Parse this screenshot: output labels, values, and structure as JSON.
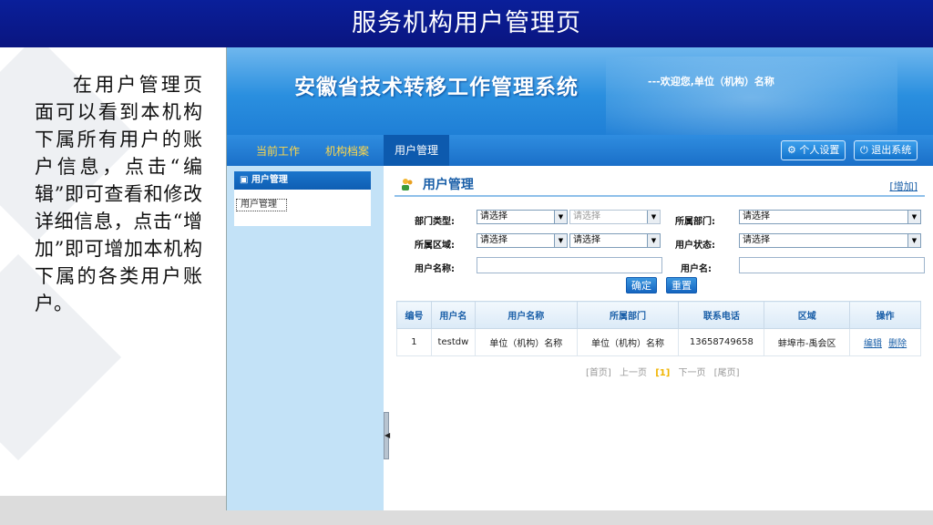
{
  "slide": {
    "title": "服务机构用户管理页",
    "description": "在用户管理页面可以看到本机构下属所有用户的账户信息，点击“编辑”即可查看和修改详细信息，点击“增加”即可增加本机构下属的各类用户账户。"
  },
  "system": {
    "title": "安徽省技术转移工作管理系统",
    "welcome": "---欢迎您,单位（机构）名称"
  },
  "nav": {
    "items": [
      "当前工作",
      "机构档案",
      "用户管理"
    ],
    "active": "用户管理",
    "settings_label": "个人设置",
    "logout_label": "退出系统",
    "settings_icon": "gear-icon",
    "logout_icon": "power-icon"
  },
  "sidebar": {
    "header": "用户管理",
    "items": [
      "用户管理"
    ]
  },
  "panel": {
    "title": "用户管理",
    "add_label": "[增加]"
  },
  "filters": {
    "dept_type_label": "部门类型:",
    "dept_type_value": "请选择",
    "dept_type_sub_value": "请选择",
    "dept_label": "所属部门:",
    "dept_value": "请选择",
    "region_label": "所属区域:",
    "region_value": "请选择",
    "region_sub_value": "请选择",
    "status_label": "用户状态:",
    "status_value": "请选择",
    "fullname_label": "用户名称:",
    "fullname_value": "",
    "username_label": "用户名:",
    "username_value": "",
    "confirm_label": "确定",
    "reset_label": "重置"
  },
  "table": {
    "headers": [
      "编号",
      "用户名",
      "用户名称",
      "所属部门",
      "联系电话",
      "区域",
      "操作"
    ],
    "rows": [
      {
        "id": "1",
        "username": "testdw",
        "fullname": "单位（机构）名称",
        "dept": "单位（机构）名称",
        "phone": "13658749658",
        "region": "蚌埠市-禹会区",
        "edit": "编辑",
        "delete": "删除"
      }
    ]
  },
  "pager": {
    "first": "[首页]",
    "prev": "上一页",
    "current": "[1]",
    "next": "下一页",
    "last": "[尾页]"
  }
}
